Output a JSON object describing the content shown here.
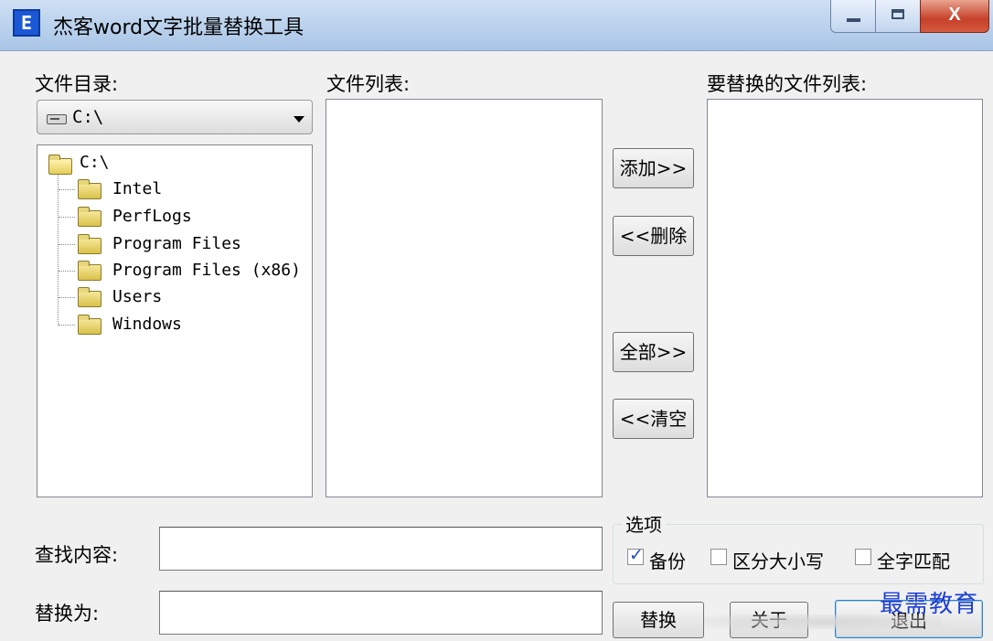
{
  "window": {
    "title": "杰客word文字批量替换工具",
    "icon_glyph": "E",
    "min_glyph": "",
    "max_glyph": "",
    "close_glyph": "X"
  },
  "labels": {
    "file_dir": "文件目录:",
    "file_list": "文件列表:",
    "replace_list": "要替换的文件列表:",
    "find": "查找内容:",
    "replace_with": "替换为:"
  },
  "drive_combo": {
    "value": "C:\\"
  },
  "tree": {
    "root": "C:\\",
    "children": [
      "Intel",
      "PerfLogs",
      "Program Files",
      "Program Files (x86)",
      "Users",
      "Windows"
    ]
  },
  "buttons": {
    "add": "添加>>",
    "remove": "<<删除",
    "all": "全部>>",
    "clear": "<<清空",
    "replace": "替换",
    "about": "关于",
    "exit": "退出"
  },
  "options": {
    "title": "选项",
    "backup": {
      "label": "备份",
      "checked": true
    },
    "case": {
      "label": "区分大小写",
      "checked": false
    },
    "whole": {
      "label": "全字匹配",
      "checked": false
    }
  },
  "inputs": {
    "find_value": "",
    "replace_value": ""
  },
  "watermark": "最需教育",
  "colors": {
    "title_gradient": "#b9d1ec",
    "close_button": "#c6402a",
    "watermark": "#1d3fd6"
  }
}
